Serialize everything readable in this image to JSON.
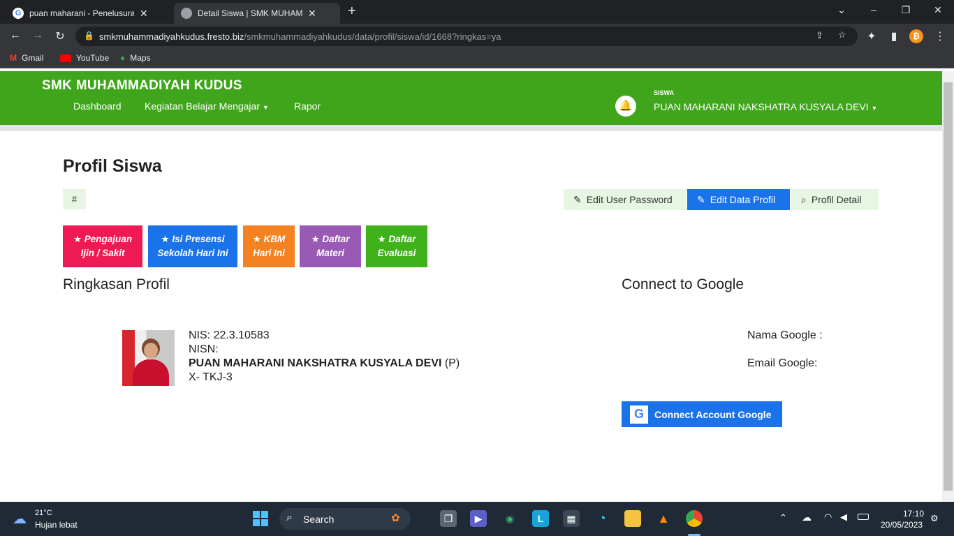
{
  "browser": {
    "tabs": [
      {
        "title": "puan maharani - Penelusuran Go",
        "close": "✕"
      },
      {
        "title": "Detail Siswa | SMK MUHAMMADI",
        "close": "✕"
      }
    ],
    "new_tab": "+",
    "url_host": "smkmuhammadiyahkudus.fresto.biz",
    "url_path": "/smkmuhammadiyahkudus/data/profil/siswa/id/1668?ringkas=ya",
    "bookmarks": [
      "Gmail",
      "YouTube",
      "Maps"
    ]
  },
  "header": {
    "site_title": "SMK MUHAMMADIYAH KUDUS",
    "menu": [
      "Dashboard",
      "Kegiatan Belajar Mengajar",
      "Rapor"
    ],
    "role": "SISWA",
    "username": "PUAN MAHARANI NAKSHATRA KUSYALA DEVI"
  },
  "page": {
    "title": "Profil Siswa",
    "hash": "#",
    "actions": {
      "edit_password": "Edit User Password",
      "edit_profile": "Edit Data Profil",
      "profile_detail": "Profil Detail"
    },
    "quick_links": [
      {
        "line1": "Pengajuan",
        "line2": "Ijin / Sakit",
        "color": "#ef1a53"
      },
      {
        "line1": "Isi Presensi",
        "line2": "Sekolah Hari Ini",
        "color": "#1a73e8"
      },
      {
        "line1": "KBM",
        "line2": "Hari Ini",
        "color": "#f58220"
      },
      {
        "line1": "Daftar",
        "line2": "Materi",
        "color": "#9b59b6"
      },
      {
        "line1": "Daftar",
        "line2": "Evaluasi",
        "color": "#3fb21b"
      }
    ],
    "summary_title": "Ringkasan Profil",
    "student": {
      "nis": "NIS: 22.3.10583",
      "nisn": "NISN:",
      "name": "PUAN MAHARANI NAKSHATRA KUSYALA DEVI",
      "gender": "(P)",
      "class": "X- TKJ-3"
    },
    "google_title": "Connect to Google",
    "google_name_label": "Nama Google :",
    "google_email_label": "Email Google:",
    "google_button": "Connect Account Google"
  },
  "taskbar": {
    "temp": "21°C",
    "weather": "Hujan lebat",
    "search": "Search",
    "time": "17:10",
    "date": "20/05/2023"
  },
  "colors": {
    "header_green": "#3fa61b",
    "primary_blue": "#1a73e8"
  }
}
